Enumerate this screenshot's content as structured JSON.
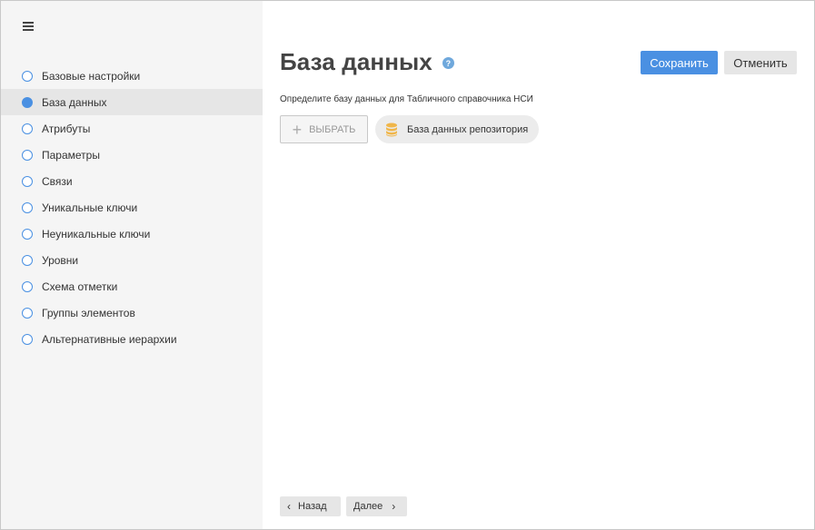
{
  "sidebar": {
    "items": [
      {
        "label": "Базовые настройки",
        "active": false
      },
      {
        "label": "База данных",
        "active": true
      },
      {
        "label": "Атрибуты",
        "active": false
      },
      {
        "label": "Параметры",
        "active": false
      },
      {
        "label": "Связи",
        "active": false
      },
      {
        "label": "Уникальные ключи",
        "active": false
      },
      {
        "label": "Неуникальные ключи",
        "active": false
      },
      {
        "label": "Уровни",
        "active": false
      },
      {
        "label": "Схема отметки",
        "active": false
      },
      {
        "label": "Группы элементов",
        "active": false
      },
      {
        "label": "Альтернативные иерархии",
        "active": false
      }
    ]
  },
  "main": {
    "title": "База данных",
    "help_icon": "?",
    "save_label": "Сохранить",
    "cancel_label": "Отменить",
    "description": "Определите базу данных для Табличного справочника НСИ",
    "choose_label": "ВЫБРАТЬ",
    "selected_db": "База данных репозитория",
    "back_label": "Назад",
    "next_label": "Далее"
  },
  "colors": {
    "accent": "#4a90e2",
    "db_icon": "#f0b64a"
  }
}
